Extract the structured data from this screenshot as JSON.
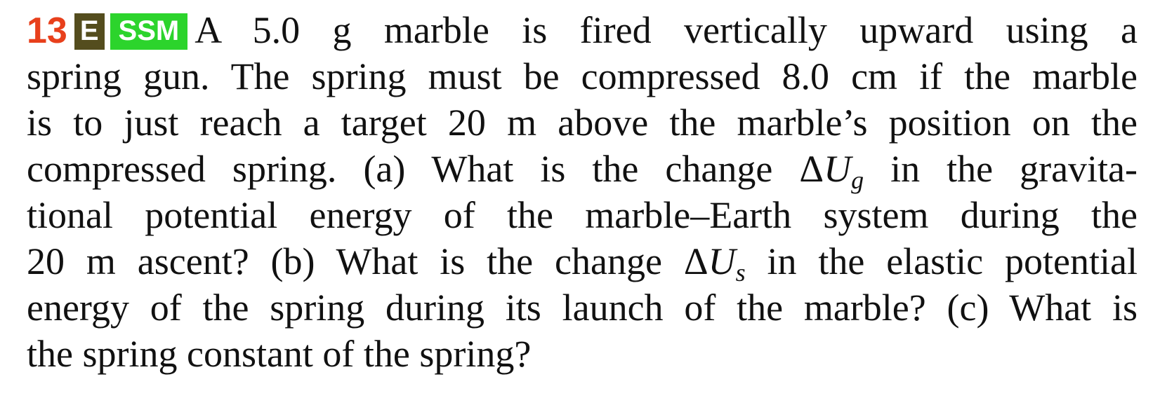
{
  "problem": {
    "number": "13",
    "badge_e": "E",
    "badge_ssm": "SSM",
    "colors": {
      "number": "#e8401c",
      "badge_e_bg": "#544d1e",
      "badge_ssm_bg": "#2cd42c"
    },
    "line1": "A 5.0 g marble is fired vertically upward using a",
    "line2": "spring gun. The spring must be compressed 8.0 cm if the marble",
    "line3": "is to just reach a target 20 m above the marble’s position on the",
    "line4_pre": "compressed spring. (a) What is the change ",
    "delta_symbol": "Δ",
    "var_u": "U",
    "sub_g": "g",
    "line4_post": " in the gravita-",
    "line5": "tional potential energy of the marble–Earth system during the",
    "line6_pre": "20 m ascent? (b) What is the change ",
    "sub_s": "s",
    "line6_post": " in the elastic potential",
    "line7": "energy of the spring during its launch of the marble? (c) What is",
    "line8": "the spring constant of the spring?"
  }
}
